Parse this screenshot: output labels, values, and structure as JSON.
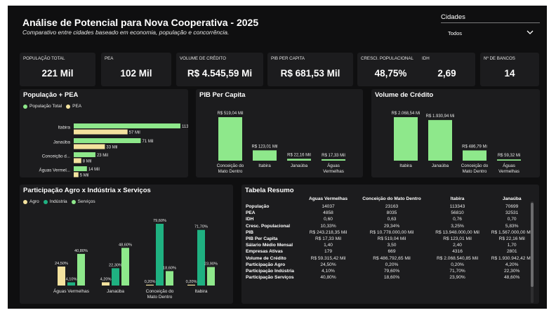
{
  "header": {
    "title": "Análise de Potencial para Nova Cooperativa - 2025",
    "subtitle": "Comparativo entre cidades baseado em economia, população e concorrência."
  },
  "slicer": {
    "title": "Cidades",
    "value": "Todos",
    "icon": "chevron-down-icon"
  },
  "kpis": [
    {
      "label": "POPULAÇÃO TOTAL",
      "value": "221 Mil"
    },
    {
      "label": "PEA",
      "value": "102 Mil"
    },
    {
      "label": "VOLUME DE CRÉDITO",
      "value": "R$ 4.545,59 Mi"
    },
    {
      "label": "PIB PER CAPITA",
      "value": "R$ 681,53 Mil"
    },
    {
      "label": "CRESCI. POPULACIONAL",
      "value": "48,75%"
    },
    {
      "label": "IDH",
      "value": "2,69"
    },
    {
      "label": "Nº DE BANCOS",
      "value": "14"
    }
  ],
  "colors": {
    "green": "#8ee88b",
    "yellow": "#f3e29e",
    "teal": "#1fb181",
    "panel": "#1c1c1e",
    "background": "#0f0f10"
  },
  "charts": {
    "pop_pea": {
      "title": "População + PEA",
      "legend": [
        "População Total",
        "PEA"
      ],
      "chart_data": {
        "type": "bar",
        "orientation": "horizontal",
        "categories": [
          "Itabira",
          "Janaúba",
          "Conceição d...",
          "Águas Vermel..."
        ],
        "series": [
          {
            "name": "População Total",
            "values": [
              113,
              71,
              23,
              14
            ],
            "labels": [
              "113 Mil",
              "71 Mil",
              "23 Mil",
              "14 Mil"
            ],
            "color": "#8ee88b"
          },
          {
            "name": "PEA",
            "values": [
              57,
              33,
              8,
              5
            ],
            "labels": [
              "57 Mil",
              "33 Mil",
              "8 Mil",
              "5 Mil"
            ],
            "color": "#f3e29e"
          }
        ]
      }
    },
    "pib": {
      "title": "PIB Per Capita",
      "chart_data": {
        "type": "bar",
        "categories": [
          "Conceição do Mato Dentro",
          "Itabira",
          "Janaúba",
          "Águas Vermelhas"
        ],
        "values": [
          519.04,
          123.01,
          22.16,
          17.33
        ],
        "labels": [
          "R$ 519,04 Mil",
          "R$ 123,01 Mil",
          "R$ 22,16 Mil",
          "R$ 17,33 Mil"
        ],
        "color": "#8ee88b"
      }
    },
    "credito": {
      "title": "Volume de Crédito",
      "chart_data": {
        "type": "bar",
        "categories": [
          "Itabira",
          "Janaúba",
          "Conceição do Mato Dentro",
          "Águas Vermelhas"
        ],
        "values": [
          2068.54,
          1930.94,
          486.79,
          59.32
        ],
        "labels": [
          "R$ 2.068,54 Mi",
          "R$ 1.930,94 Mi",
          "R$ 486,79 Mi",
          "R$ 59,32 Mi"
        ],
        "color": "#8ee88b"
      }
    },
    "setores": {
      "title": "Participação Agro x Indústria x Serviços",
      "legend": [
        "Agro",
        "Indústria",
        "Serviços"
      ],
      "chart_data": {
        "type": "bar",
        "categories": [
          "Águas Vermelhas",
          "Janaúba",
          "Conceição do Mato Dentro",
          "Itabira"
        ],
        "series": [
          {
            "name": "Agro",
            "values": [
              24.5,
              4.2,
              0.2,
              0.2
            ],
            "labels": [
              "24,50%",
              "4,20%",
              "0,20%",
              "0,20%"
            ],
            "color": "#f3e29e"
          },
          {
            "name": "Indústria",
            "values": [
              4.1,
              22.3,
              79.6,
              71.7
            ],
            "labels": [
              "4,10%",
              "22,30%",
              "79,60%",
              "71,70%"
            ],
            "color": "#1fb181"
          },
          {
            "name": "Serviços",
            "values": [
              40.8,
              48.6,
              18.6,
              23.9
            ],
            "labels": [
              "40,80%",
              "48,60%",
              "18,60%",
              "23,90%"
            ],
            "color": "#8ee88b"
          }
        ]
      }
    }
  },
  "table": {
    "title": "Tabela Resumo",
    "columns": [
      "",
      "Aguas Vermelhas",
      "Conceição do Mato Dentro",
      "Itabira",
      "Janaúba"
    ],
    "rows": [
      [
        "População",
        "14037",
        "23163",
        "113343",
        "70699"
      ],
      [
        "PEA",
        "4858",
        "8035",
        "56810",
        "32531"
      ],
      [
        "IDH",
        "0,60",
        "0,63",
        "0,76",
        "0,70"
      ],
      [
        "Cresc. Populacional",
        "10,33%",
        "29,34%",
        "3,25%",
        "5,83%"
      ],
      [
        "PIB",
        "R$ 243.218,35 Mil",
        "R$ 10.778.000,00 Mil",
        "R$ 13.948.000,00 Mil",
        "R$ 1.567.000,00 Mil"
      ],
      [
        "PIB Per Capita",
        "R$ 17,33 Mil",
        "R$ 519,04 Mil",
        "R$ 123,01 Mil",
        "R$ 22,16 Mil"
      ],
      [
        "Sálario Médio Mensal",
        "1,40",
        "3,50",
        "2,40",
        "1,70"
      ],
      [
        "Empresas Ativas",
        "179",
        "669",
        "4316",
        "2801"
      ],
      [
        "Volume de Crédito",
        "R$ 59.315,42 Mil",
        "R$ 486.792,65 Mil",
        "R$ 2.068.540,85 Mil",
        "R$ 1.930.942,42 Mil"
      ],
      [
        "Participação Agro",
        "24,50%",
        "0,20%",
        "0,20%",
        "4,20%"
      ],
      [
        "Participação Indústria",
        "4,10%",
        "79,60%",
        "71,70%",
        "22,30%"
      ],
      [
        "Participação Serviços",
        "40,80%",
        "18,60%",
        "23,90%",
        "48,60%"
      ]
    ]
  }
}
